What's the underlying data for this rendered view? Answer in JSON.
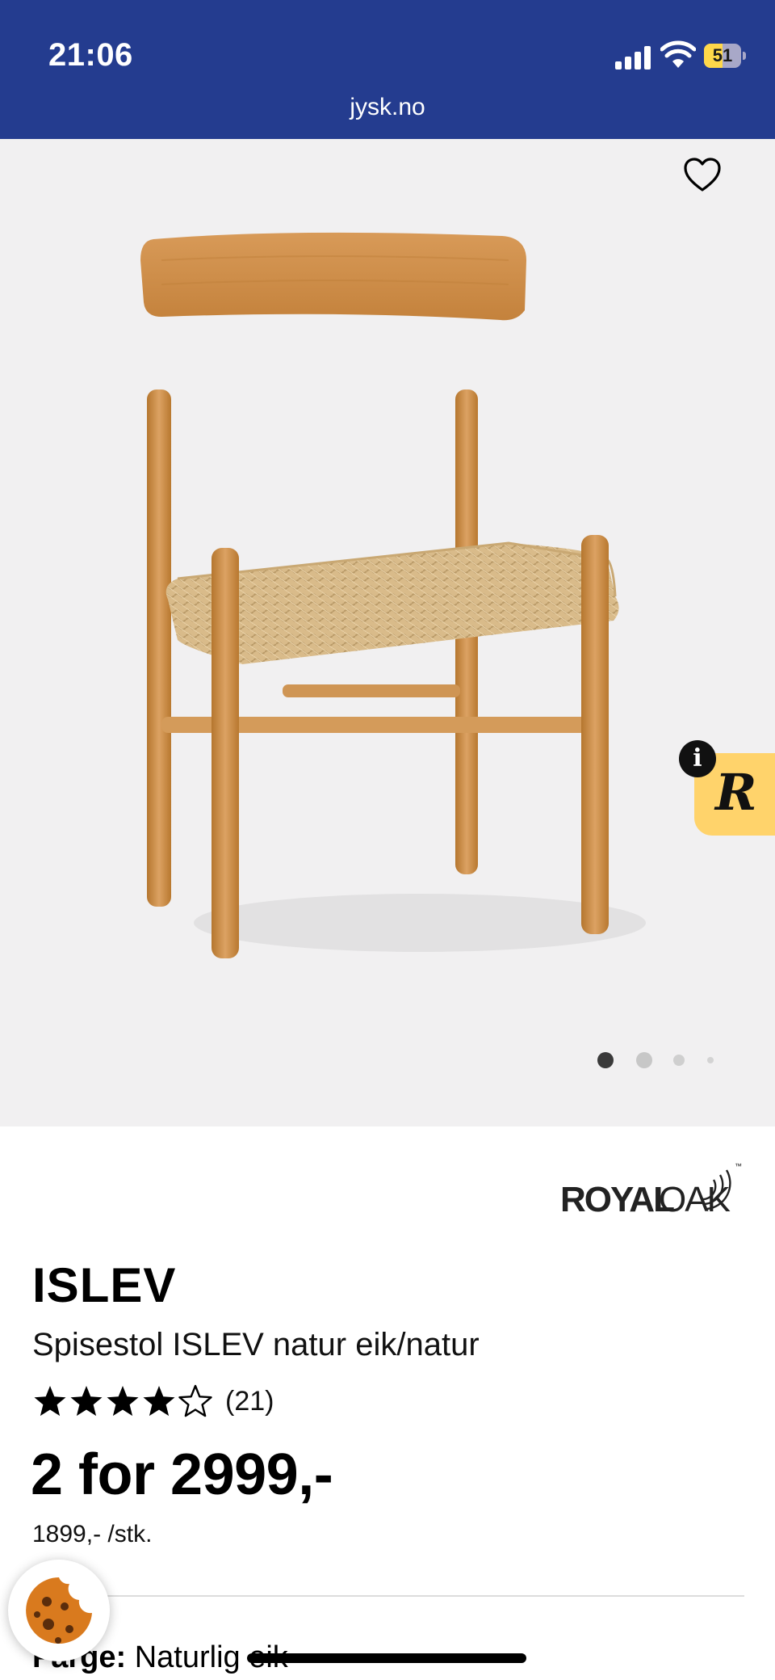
{
  "status_bar": {
    "time": "21:06",
    "battery_percent": "51",
    "battery_level": 0.51
  },
  "browser": {
    "url": "jysk.no"
  },
  "gallery": {
    "image_icon": "chair-photo",
    "favorite_icon": "heart-outline-icon",
    "slide_count": 4,
    "active_slide": 1
  },
  "review_widget": {
    "letter": "R",
    "info_letter": "i"
  },
  "product": {
    "brand_logo": {
      "part1": "ROYAL",
      "part2": "OAK",
      "tm": "™"
    },
    "name": "ISLEV",
    "description": "Spisestol ISLEV natur eik/natur",
    "rating": {
      "stars": 4,
      "max": 5,
      "count_text": "(21)"
    },
    "price": "2 for 2999,-",
    "unit_price": "1899,- /stk.",
    "color_label": "Farge:",
    "color_value": "Naturlig eik"
  },
  "colors": {
    "header_bg": "#243c8f",
    "gallery_bg": "#f1f0f1",
    "widget_yellow": "#ffd36b",
    "cookie_orange": "#d97a1e"
  }
}
